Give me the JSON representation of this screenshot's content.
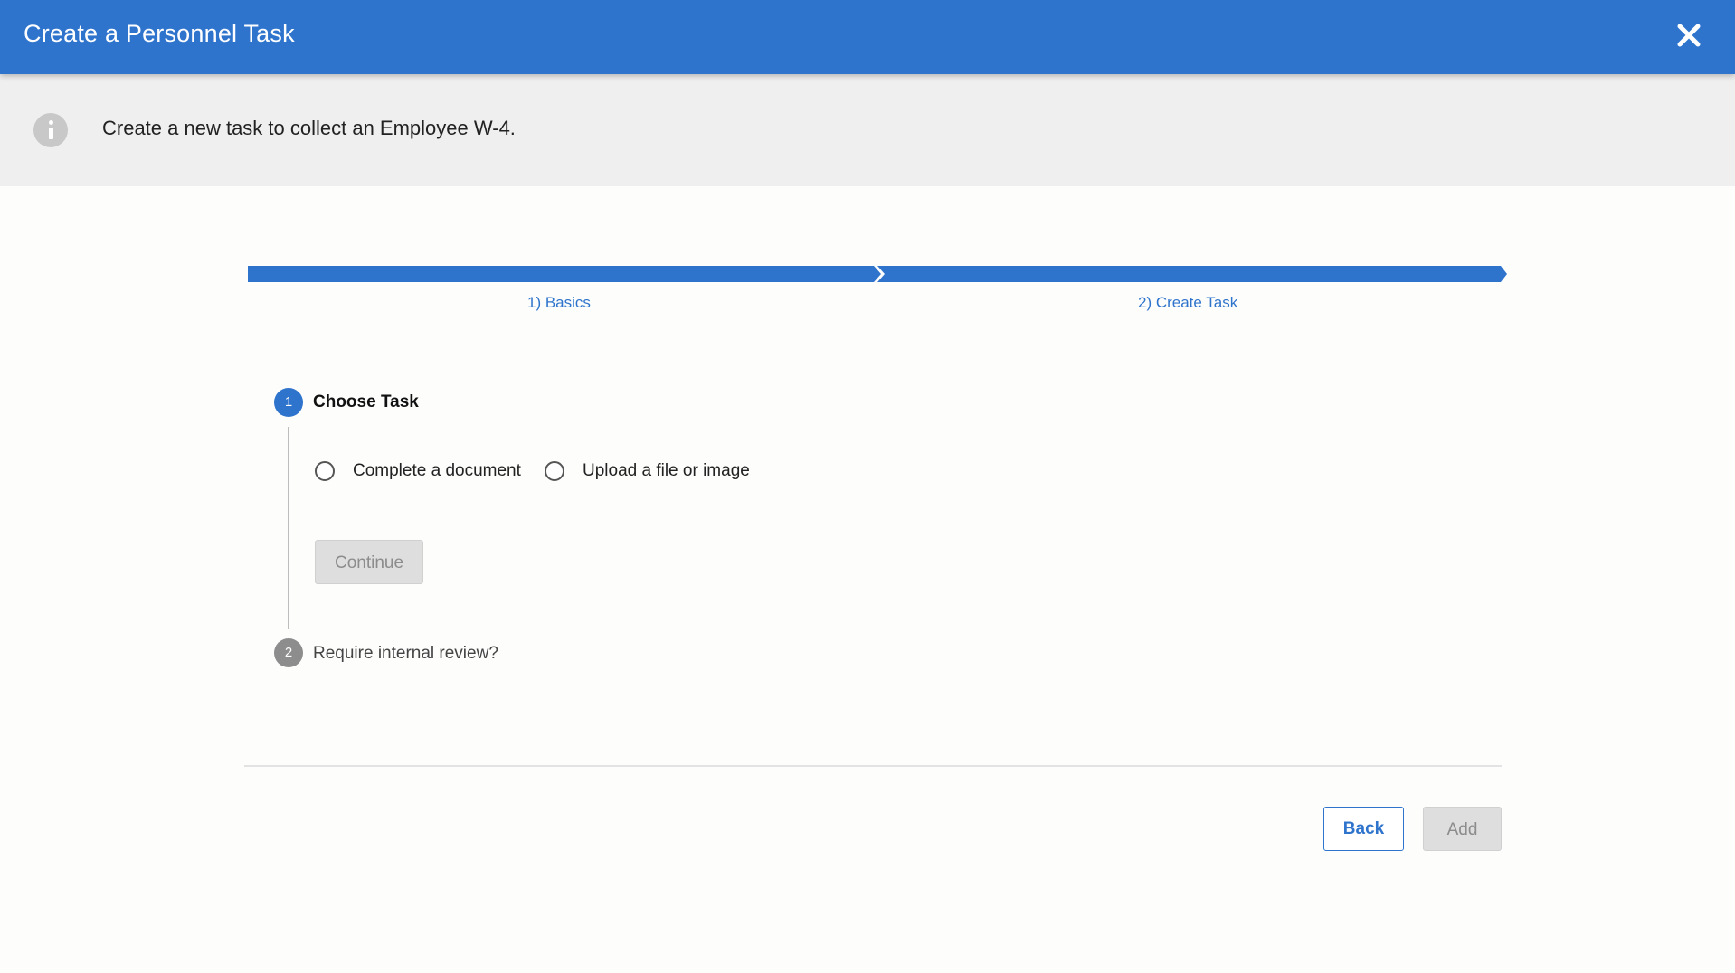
{
  "header": {
    "title": "Create a Personnel Task",
    "close_icon": "close-icon",
    "background_color": "#2f74cc"
  },
  "info_banner": {
    "icon": "info-icon",
    "text": "Create a new task to collect an Employee W-4."
  },
  "progress": {
    "steps": [
      {
        "label": "1) Basics"
      },
      {
        "label": "2) Create Task"
      }
    ],
    "color": "#2f74cc"
  },
  "stepper": {
    "steps": [
      {
        "number": "1",
        "title": "Choose Task",
        "state": "active",
        "options": [
          {
            "label": "Complete a document",
            "selected": false
          },
          {
            "label": "Upload a file or image",
            "selected": false
          }
        ],
        "continue_label": "Continue"
      },
      {
        "number": "2",
        "title": "Require internal review?",
        "state": "pending"
      }
    ]
  },
  "footer": {
    "back_label": "Back",
    "add_label": "Add"
  }
}
